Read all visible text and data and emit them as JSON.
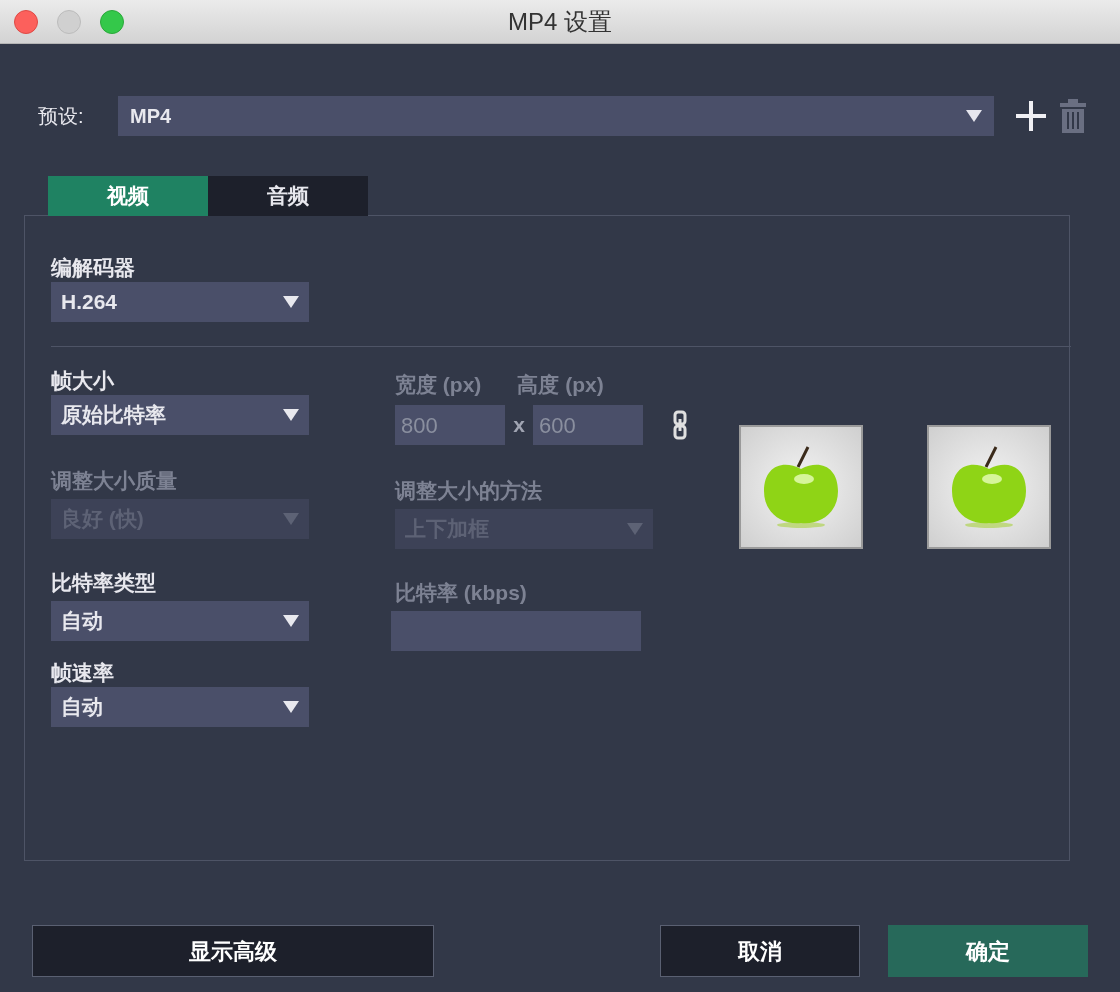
{
  "window": {
    "title": "MP4 设置"
  },
  "preset": {
    "label": "预设:",
    "value": "MP4"
  },
  "tabs": [
    {
      "label": "视频",
      "selected": true
    },
    {
      "label": "音频",
      "selected": false
    }
  ],
  "codec": {
    "label": "编解码器",
    "value": "H.264"
  },
  "frame_size": {
    "label": "帧大小",
    "value": "原始比特率"
  },
  "width": {
    "label": "宽度 (px)",
    "value": "800",
    "disabled": true
  },
  "separator": "x",
  "height": {
    "label": "高度 (px)",
    "value": "600",
    "disabled": true
  },
  "resize_quality": {
    "label": "调整大小质量",
    "value": "良好 (快)",
    "disabled": true
  },
  "resize_method": {
    "label": "调整大小的方法",
    "value": "上下加框",
    "disabled": true
  },
  "bitrate_type": {
    "label": "比特率类型",
    "value": "自动"
  },
  "bitrate": {
    "label": "比特率 (kbps)",
    "disabled": true
  },
  "frame_rate": {
    "label": "帧速率",
    "value": "自动"
  },
  "buttons": [
    {
      "label": "显示高级",
      "kind": "secondary"
    },
    {
      "label": "取消",
      "kind": "secondary"
    },
    {
      "label": "确定",
      "kind": "primary"
    }
  ]
}
